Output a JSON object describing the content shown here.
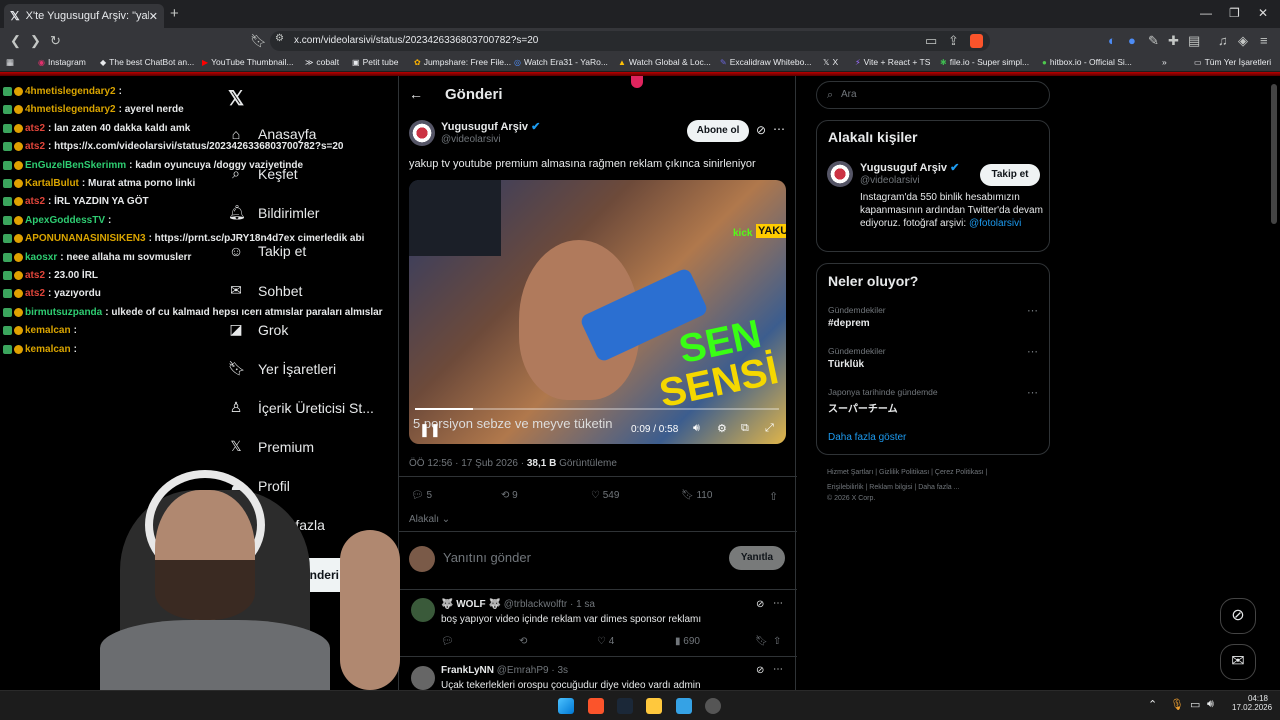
{
  "browser": {
    "tab_title": "X'te Yugusuguf Arşiv: \"yakup",
    "url": "x.com/videolarsivi/status/2023426336803700782?s=20",
    "bookmarks": [
      "Instagram",
      "The best ChatBot an...",
      "YouTube Thumbnail...",
      "cobalt",
      "Petit tube",
      "Jumpshare: Free File...",
      "Watch Era31 - YaRo...",
      "Watch Global & Loc...",
      "Excalidraw Whitebo...",
      "X",
      "Vite + React + TS",
      "file.io - Super simpl...",
      "hitbox.io - Official Si..."
    ],
    "all_bookmarks": "Tüm Yer İşaretleri"
  },
  "chat": [
    {
      "user": "4hmetislegendary2",
      "text": ":",
      "color": "#d9a400"
    },
    {
      "user": "4hmetislegendary2",
      "text": ": ayerel nerde",
      "color": "#d9a400"
    },
    {
      "user": "ats2",
      "text": ": lan zaten 40 dakka kaldı amk",
      "color": "#e0453a"
    },
    {
      "user": "ats2",
      "text": ": https://x.com/videolarsivi/status/2023426336803700782?s=20",
      "color": "#e0453a"
    },
    {
      "user": "EnGuzelBenSkerimm",
      "text": ": kadın oyuncuya /doggy vaziyetinde",
      "color": "#2ecc71"
    },
    {
      "user": "KartalBulut",
      "text": ": Murat atma porno linki",
      "color": "#d9a400"
    },
    {
      "user": "ats2",
      "text": ": İRL YAZDIN YA GÖT",
      "color": "#e0453a"
    },
    {
      "user": "ApexGoddessTV",
      "text": ":",
      "color": "#2ecc71"
    },
    {
      "user": "APONUNANASINISIKEN3",
      "text": ": https://prnt.sc/pJRY18n4d7ex cimerledik abi",
      "color": "#d9a400"
    },
    {
      "user": "kaosxr",
      "text": ": neee allaha mı sovmuslerr",
      "color": "#2ecc71"
    },
    {
      "user": "ats2",
      "text": ": 23.00 İRL",
      "color": "#e0453a"
    },
    {
      "user": "ats2",
      "text": ": yazıyordu",
      "color": "#e0453a"
    },
    {
      "user": "birmutsuzpanda",
      "text": ": ulkede of cu kalmaıd hepsı ıcerı atmıslar paraları almıslar",
      "color": "#2ecc71"
    },
    {
      "user": "kemalcan",
      "text": ":",
      "color": "#d9a400"
    },
    {
      "user": "kemalcan",
      "text": ":",
      "color": "#d9a400"
    }
  ],
  "nav": {
    "home": "Anasayfa",
    "explore": "Keşfet",
    "notifications": "Bildirimler",
    "follow": "Takip et",
    "chat": "Sohbet",
    "grok": "Grok",
    "bookmarks": "Yer İşaretleri",
    "creator": "İçerik Üreticisi St...",
    "premium": "Premium",
    "profile": "Profil",
    "more": "Daha fazla",
    "post_btn": "Gönderi yayınla"
  },
  "post": {
    "header": "Gönderi",
    "name": "Yugusuguf Arşiv",
    "handle": "@videolarsivi",
    "subscribe": "Abone ol",
    "text": "yakup tv youtube premium almasına rağmen reklam çıkınca sinirleniyor",
    "video_caption": "5 porsiyon sebze ve meyve tüketin",
    "video_time": "0:09 / 0:58",
    "progress": 0.16,
    "overlay_text": "SEN",
    "overlay_text2": "SENSİ",
    "brand": "kick",
    "brand2": "YAKU",
    "time": "ÖÖ 12:56 · 17 Şub 2026 ·",
    "views": "38,1 B",
    "views_label": "Görüntüleme",
    "replies": "5",
    "reposts": "9",
    "likes": "549",
    "bookmarks": "110",
    "related": "Alakalı",
    "reply_placeholder": "Yanıtını gönder",
    "reply_btn": "Yanıtla"
  },
  "replies": [
    {
      "name": "🐺 WOLF 🐺",
      "handle": "@trblackwolftr · 1 sa",
      "text": "boş yapıyor video içinde reklam var dimes sponsor reklamı",
      "likes": "4",
      "views": "690"
    },
    {
      "name": "FrankLyNN",
      "handle": "@EmrahP9 · 3s",
      "text": "Uçak tekerlekleri orospu çocuğudur diye video vardı admin"
    }
  ],
  "right": {
    "search": "Ara",
    "related_title": "Alakalı kişiler",
    "name": "Yugusuguf Arşiv",
    "handle": "@videolarsivi",
    "follow": "Takip et",
    "bio": "Instagram'da 550 binlik hesabımızın kapanmasının ardından Twitter'da devam ediyoruz. fotoğraf arşivi:",
    "bio_link": "@fotolarsivi",
    "trends_title": "Neler oluyor?",
    "trends": [
      {
        "cat": "Gündemdekiler",
        "name": "#deprem"
      },
      {
        "cat": "Gündemdekiler",
        "name": "Türklük"
      },
      {
        "cat": "Japonya tarihinde gündemde",
        "name": "スーパーチーム"
      }
    ],
    "show_more": "Daha fazla göster",
    "footer1": [
      "Hizmet Şartları",
      "Gizlilik Politikası",
      "Çerez Politikası"
    ],
    "footer2": [
      "Erişilebilirlik",
      "Reklam bilgisi",
      "Daha fazla ..."
    ],
    "copyright": "© 2026 X Corp."
  },
  "taskbar": {
    "time": "04:18",
    "date": "17.02.2026"
  }
}
